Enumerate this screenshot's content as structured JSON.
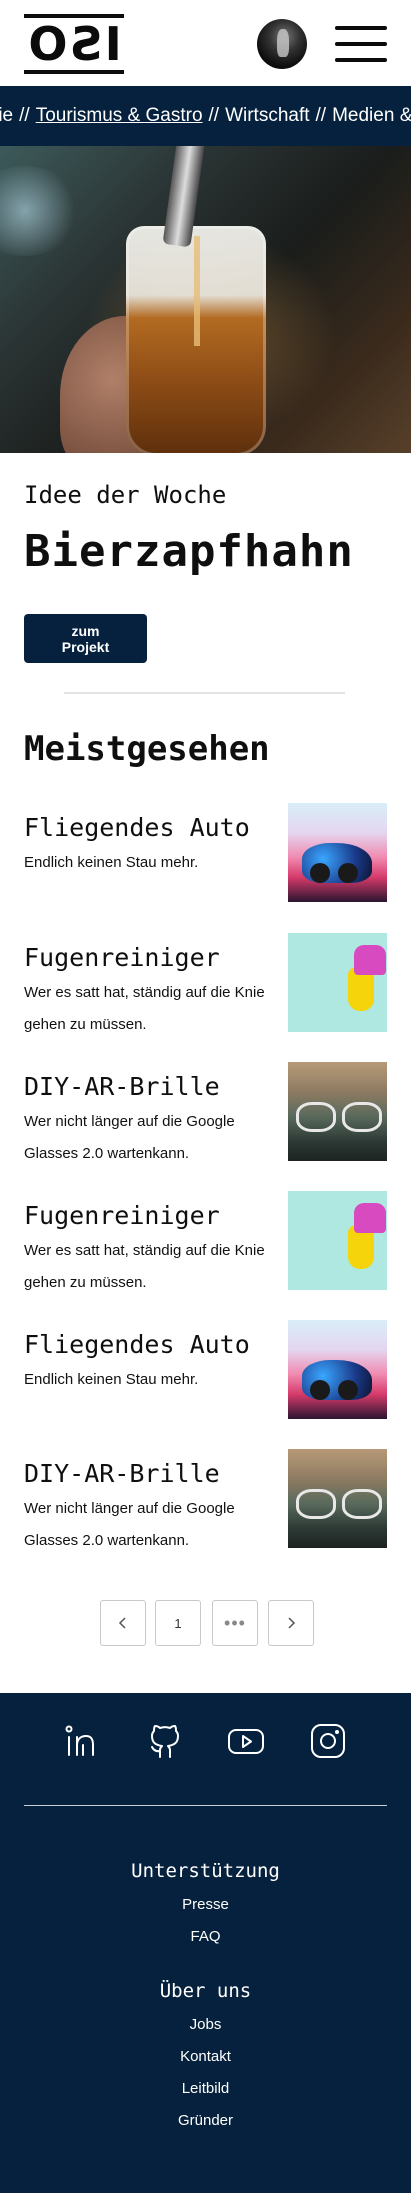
{
  "header": {
    "logo_text": "ISO",
    "avatar_alt": "Profile",
    "menu_label": "Menu"
  },
  "ticker": {
    "items": [
      {
        "label": "rie",
        "link": false
      },
      {
        "label": "Tourismus & Gastro",
        "link": true
      },
      {
        "label": "Wirtschaft",
        "link": false
      },
      {
        "label": "Medien &",
        "link": false
      }
    ],
    "separator": "//"
  },
  "idea": {
    "label": "Idee der Woche",
    "title": "Bierzapfhahn",
    "button_label": "zum\nProjekt"
  },
  "most_viewed": {
    "title": "Meistgesehen",
    "items": [
      {
        "title": "Fliegendes Auto",
        "description": "Endlich keinen Stau mehr.",
        "image": "car"
      },
      {
        "title": "Fugenreiniger",
        "description": "Wer es satt hat, ständig auf die Knie gehen zu müssen.",
        "image": "spray"
      },
      {
        "title": "DIY-AR-Brille",
        "description": "Wer nicht länger auf die Google Glasses 2.0 wartenkann.",
        "image": "glasses"
      },
      {
        "title": "Fugenreiniger",
        "description": "Wer es satt hat, ständig auf die Knie gehen zu müssen.",
        "image": "spray"
      },
      {
        "title": "Fliegendes Auto",
        "description": "Endlich keinen Stau mehr.",
        "image": "car"
      },
      {
        "title": "DIY-AR-Brille",
        "description": "Wer nicht länger auf die Google Glasses 2.0 wartenkann.",
        "image": "glasses"
      }
    ]
  },
  "pagination": {
    "prev_icon": "chevron-left-icon",
    "current_page": "1",
    "more": "•••",
    "next_icon": "chevron-right-icon"
  },
  "footer": {
    "social": [
      "linkedin-icon",
      "github-icon",
      "youtube-icon",
      "instagram-icon"
    ],
    "support_heading": "Unterstützung",
    "support_links": [
      "Presse",
      "FAQ"
    ],
    "about_heading": "Über uns",
    "about_links": [
      "Jobs",
      "Kontakt",
      "Leitbild",
      "Gründer"
    ]
  },
  "colors": {
    "navy": "#06213d",
    "text": "#0f0f0f",
    "divider": "#e3e3e3"
  }
}
